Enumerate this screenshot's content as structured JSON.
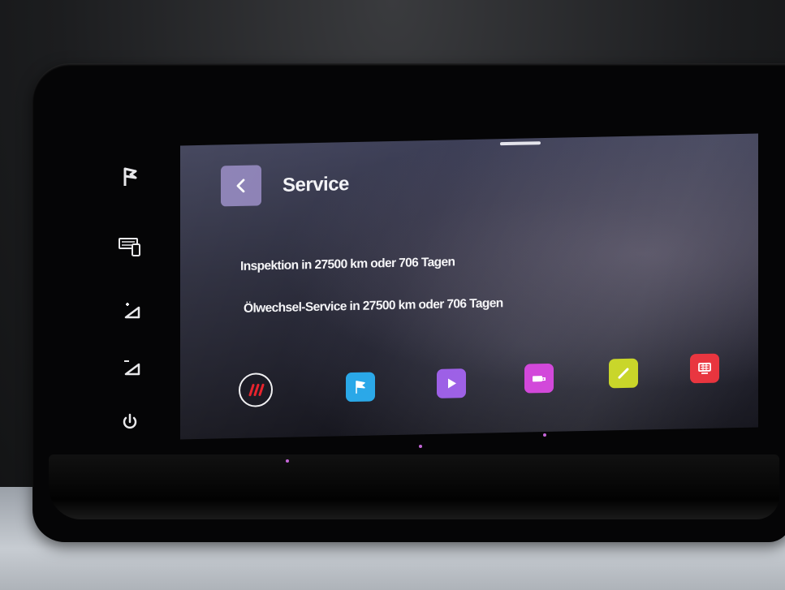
{
  "header": {
    "title": "Service",
    "back_icon": "chevron-left-icon"
  },
  "service": {
    "lines": [
      "Inspektion in 27500 km oder 706 Tagen",
      "Ölwechsel-Service in 27500 km oder 706 Tagen"
    ]
  },
  "side_buttons": [
    {
      "icon": "flag-icon"
    },
    {
      "icon": "keyboard-phone-icon"
    },
    {
      "icon": "volume-up-icon"
    },
    {
      "icon": "volume-down-icon"
    },
    {
      "icon": "power-icon"
    }
  ],
  "dock": [
    {
      "icon": "home-stripes-icon",
      "color": "#e8202a"
    },
    {
      "icon": "flag-icon",
      "color": "#2aa8e8"
    },
    {
      "icon": "play-icon",
      "color": "#9b5de5"
    },
    {
      "icon": "car-icon",
      "color": "#d040d8"
    },
    {
      "icon": "phone-icon",
      "color": "#c6d41e"
    },
    {
      "icon": "car-settings-icon",
      "color": "#e8303a"
    }
  ],
  "colors": {
    "back_button": "#8a7fb4",
    "screen_background": "#2a2b3b"
  }
}
